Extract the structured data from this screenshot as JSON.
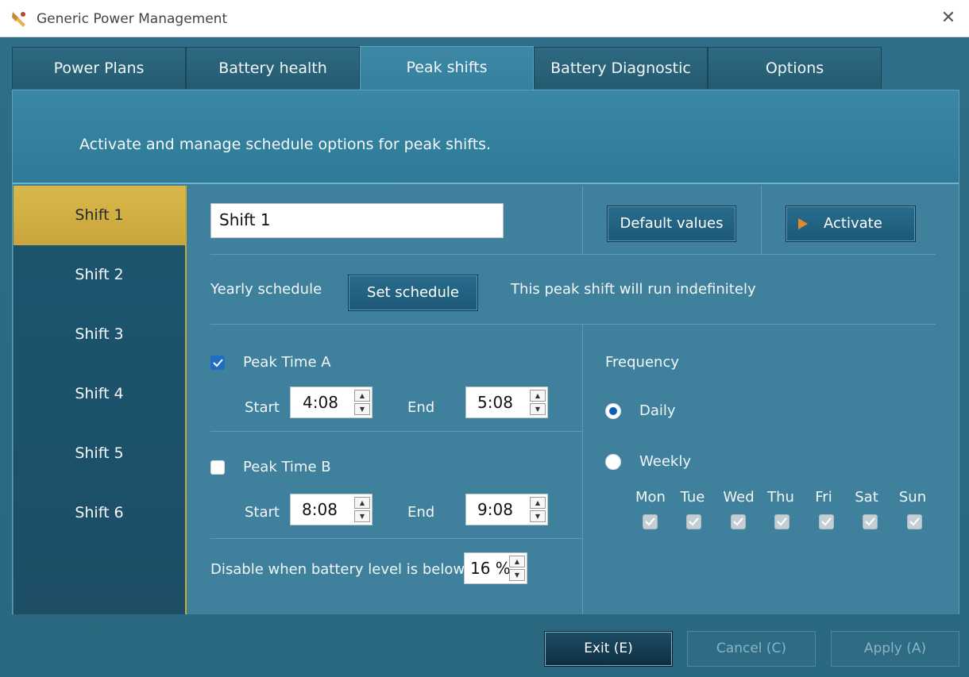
{
  "window": {
    "title": "Generic Power Management"
  },
  "tabs": [
    {
      "label": "Power Plans"
    },
    {
      "label": "Battery health"
    },
    {
      "label": "Peak shifts"
    },
    {
      "label": "Battery Diagnostic"
    },
    {
      "label": "Options"
    }
  ],
  "banner": {
    "text": "Activate and manage schedule options for peak shifts."
  },
  "shifts": [
    {
      "label": "Shift 1"
    },
    {
      "label": "Shift 2"
    },
    {
      "label": "Shift 3"
    },
    {
      "label": "Shift 4"
    },
    {
      "label": "Shift 5"
    },
    {
      "label": "Shift 6"
    }
  ],
  "shift_name": {
    "value": "Shift 1"
  },
  "buttons": {
    "default_values": "Default values",
    "activate": "Activate",
    "set_schedule": "Set schedule"
  },
  "schedule": {
    "label": "Yearly schedule",
    "status": "This peak shift will run indefinitely"
  },
  "peak_a": {
    "label": "Peak Time A",
    "checked": true,
    "start_label": "Start",
    "start": "4:08",
    "end_label": "End",
    "end": "5:08"
  },
  "peak_b": {
    "label": "Peak Time B",
    "checked": false,
    "start_label": "Start",
    "start": "8:08",
    "end_label": "End",
    "end": "9:08"
  },
  "battery": {
    "label": "Disable when battery level is below",
    "value": "16 %"
  },
  "frequency": {
    "label": "Frequency",
    "daily": "Daily",
    "weekly": "Weekly",
    "selected": "Daily",
    "days": [
      "Mon",
      "Tue",
      "Wed",
      "Thu",
      "Fri",
      "Sat",
      "Sun"
    ]
  },
  "footer": {
    "exit": "Exit (E)",
    "cancel": "Cancel (C)",
    "apply": "Apply (A)"
  },
  "colors": {
    "accent_yellow": "#d9b84a",
    "activate_arrow": "#e08a2a",
    "check_blue": "#1f6fc0"
  }
}
